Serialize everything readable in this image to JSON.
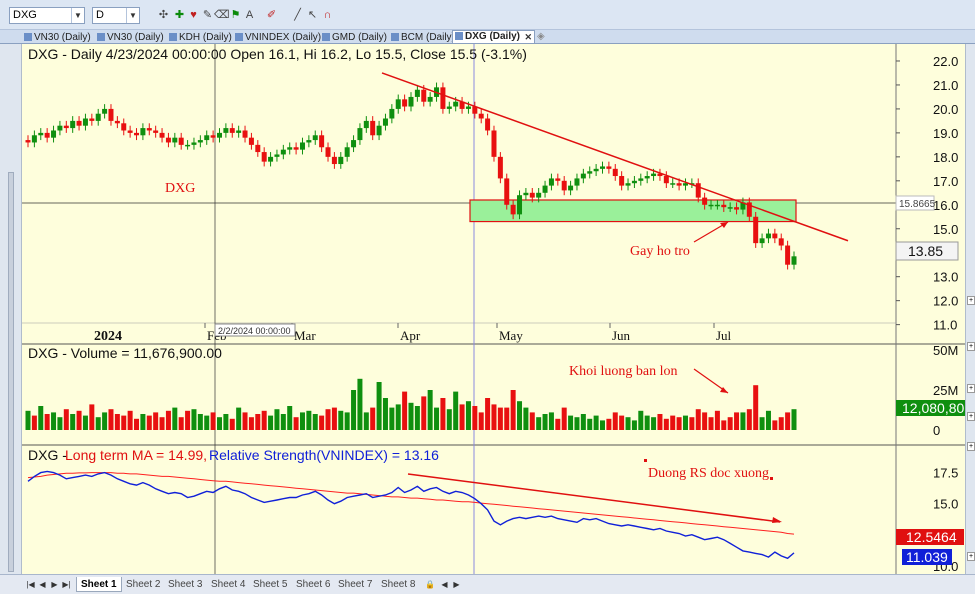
{
  "toolbar": {
    "symbol": "DXG",
    "period": "D",
    "icons": [
      "crosshair-icon",
      "add-chart-icon",
      "heart-icon",
      "draw-icon",
      "eraser-icon",
      "flag-icon",
      "text-icon",
      "pen-color-icon",
      "line-tool-icon",
      "pointer-icon",
      "curve-icon",
      "magnet-icon"
    ]
  },
  "tabs": [
    {
      "label": "VN30 (Daily)",
      "active": false
    },
    {
      "label": "VN30 (Daily)",
      "active": false
    },
    {
      "label": "KDH (Daily)",
      "active": false
    },
    {
      "label": "VNINDEX (Daily)",
      "active": false
    },
    {
      "label": "GMD (Daily)",
      "active": false
    },
    {
      "label": "BCM (Daily)",
      "active": false
    },
    {
      "label": "DXG (Daily)",
      "active": true
    }
  ],
  "colors": {
    "bg": "#fefedc",
    "up": "#0f8f0f",
    "down": "#e81010",
    "ma": "#ff2020",
    "rs": "#1020d8",
    "trend": "#e01010",
    "support_fill": "#9af09a",
    "support_border": "#e01010"
  },
  "chart_data": [
    {
      "type": "candlestick",
      "title": "DXG - Daily 4/23/2024 00:00:00 Open 16.1, Hi 16.2, Lo 15.5, Close 15.5 (-3.1%)",
      "ylim": [
        10.4,
        22.5
      ],
      "yticks": [
        "22.0",
        "21.0",
        "20.0",
        "19.0",
        "18.0",
        "17.0",
        "16.0",
        "15.0",
        "14.0",
        "13.0",
        "12.0",
        "11.0"
      ],
      "x_year_label": "2024",
      "x_month_labels": [
        "Feb",
        "Mar",
        "Apr",
        "May",
        "Jun",
        "Jul"
      ],
      "cursor_date": "2/2/2024 00:00:00",
      "cursor_price": "15.8665",
      "last_price": "13.85",
      "watermark": "DXG",
      "annotations": [
        "Gay ho tro"
      ],
      "close": [
        18.6,
        18.9,
        19.0,
        18.8,
        19.1,
        19.3,
        19.2,
        19.5,
        19.3,
        19.6,
        19.5,
        19.8,
        20.0,
        19.5,
        19.4,
        19.1,
        19.0,
        18.9,
        19.2,
        19.1,
        19.0,
        18.8,
        18.6,
        18.8,
        18.5,
        18.5,
        18.6,
        18.7,
        18.9,
        18.8,
        19.0,
        19.2,
        19.0,
        19.1,
        18.8,
        18.5,
        18.2,
        17.8,
        18.0,
        18.1,
        18.3,
        18.4,
        18.3,
        18.6,
        18.7,
        18.9,
        18.4,
        18.0,
        17.7,
        18.0,
        18.4,
        18.7,
        19.2,
        19.5,
        18.9,
        19.3,
        19.6,
        20.0,
        20.4,
        20.1,
        20.5,
        20.8,
        20.3,
        20.5,
        20.9,
        20.0,
        20.1,
        20.3,
        20.0,
        20.1,
        19.8,
        19.6,
        19.1,
        18.0,
        17.1,
        16.0,
        15.6,
        16.4,
        16.5,
        16.3,
        16.5,
        16.8,
        17.1,
        17.0,
        16.6,
        16.8,
        17.1,
        17.3,
        17.4,
        17.5,
        17.6,
        17.5,
        17.2,
        16.8,
        16.9,
        17.0,
        17.1,
        17.2,
        17.3,
        17.2,
        16.9,
        16.9,
        16.8,
        16.9,
        16.9,
        16.3,
        16.0,
        16.0,
        16.0,
        15.9,
        15.9,
        15.8,
        16.1,
        15.5,
        14.4,
        14.6,
        14.8,
        14.6,
        14.3,
        13.5,
        13.85
      ],
      "volume_header": "DXG - Volume = 11,676,900.00",
      "volume_ylim": [
        0,
        50000000
      ],
      "volume_ticks": [
        "50M",
        "25M",
        "0"
      ],
      "volume_last": "12,080,80",
      "volume_annotations": [
        "Khoi luong ban lon"
      ],
      "volume": [
        12,
        9,
        15,
        10,
        11,
        8,
        13,
        10,
        12,
        9,
        16,
        8,
        11,
        13,
        10,
        9,
        12,
        7,
        10,
        9,
        11,
        8,
        12,
        14,
        8,
        12,
        13,
        10,
        9,
        11,
        8,
        10,
        7,
        14,
        11,
        8,
        10,
        12,
        9,
        13,
        10,
        15,
        8,
        11,
        12,
        10,
        9,
        13,
        14,
        12,
        11,
        25,
        32,
        11,
        14,
        30,
        20,
        14,
        16,
        24,
        17,
        15,
        21,
        25,
        14,
        20,
        13,
        24,
        16,
        18,
        15,
        11,
        20,
        16,
        14,
        14,
        25,
        18,
        14,
        11,
        8,
        10,
        11,
        7,
        14,
        9,
        8,
        10,
        7,
        9,
        6,
        7,
        11,
        9,
        8,
        6,
        12,
        9,
        8,
        10,
        7,
        9,
        8,
        9,
        8,
        13,
        11,
        8,
        12,
        6,
        8,
        11,
        11,
        13,
        28,
        8,
        12,
        6,
        8,
        11,
        13
      ],
      "volume_up": [
        true,
        false,
        true,
        false,
        true,
        true,
        false,
        true,
        false,
        true,
        false,
        true,
        true,
        false,
        false,
        false,
        false,
        false,
        true,
        false,
        false,
        false,
        false,
        true,
        false,
        false,
        true,
        true,
        true,
        false,
        true,
        true,
        false,
        true,
        false,
        false,
        false,
        false,
        true,
        true,
        true,
        true,
        false,
        true,
        true,
        true,
        false,
        false,
        false,
        true,
        true,
        true,
        true,
        true,
        false,
        true,
        true,
        true,
        true,
        false,
        true,
        true,
        false,
        true,
        true,
        false,
        true,
        true,
        false,
        true,
        false,
        false,
        false,
        false,
        false,
        false,
        false,
        true,
        true,
        false,
        true,
        true,
        true,
        false,
        false,
        true,
        true,
        true,
        true,
        true,
        true,
        false,
        false,
        false,
        true,
        true,
        true,
        true,
        true,
        false,
        false,
        false,
        false,
        true,
        false,
        false,
        false,
        false,
        false,
        false,
        false,
        false,
        true,
        false,
        false,
        true,
        true,
        false,
        false,
        false,
        true
      ]
    },
    {
      "type": "line",
      "title": "DXG - Long term MA = 14.99, Relative Strength(VNINDEX) = 13.16",
      "ylim": [
        9.5,
        19.0
      ],
      "yticks": [
        "17.5",
        "15.0",
        "12.5",
        "10.0"
      ],
      "ma_label": "Long term MA = 14.99",
      "rs_label": "Relative Strength(VNINDEX) = 13.16",
      "ma_last": "12.5464",
      "rs_last": "11.039",
      "annotations": [
        "Duong RS doc xuong"
      ],
      "series": [
        {
          "name": "Long term MA",
          "values": [
            17.1,
            17.15,
            17.2,
            17.3,
            17.35,
            17.4,
            17.45,
            17.45,
            17.48,
            17.48,
            17.5,
            17.5,
            17.5,
            17.5,
            17.45,
            17.45,
            17.4,
            17.4,
            17.35,
            17.3,
            17.25,
            17.2,
            17.2,
            17.15,
            17.1,
            17.05,
            17.0,
            16.95,
            16.9,
            16.85,
            16.8,
            16.8,
            16.75,
            16.7,
            16.65,
            16.6,
            16.55,
            16.5,
            16.45,
            16.4,
            16.35,
            16.3,
            16.25,
            16.2,
            16.15,
            16.1,
            16.05,
            16.0,
            15.95,
            15.9,
            15.85,
            15.85,
            15.8,
            15.75,
            15.7,
            15.65,
            15.6,
            15.55,
            15.55,
            15.5,
            15.45,
            15.45,
            15.4,
            15.35,
            15.3,
            15.3,
            15.25,
            15.2,
            15.15,
            15.15,
            15.1,
            15.05,
            15.0,
            14.95,
            14.9,
            14.85,
            14.8,
            14.75,
            14.7,
            14.65,
            14.6,
            14.55,
            14.5,
            14.45,
            14.4,
            14.35,
            14.3,
            14.25,
            14.2,
            14.15,
            14.1,
            14.05,
            14.0,
            13.95,
            13.9,
            13.85,
            13.8,
            13.75,
            13.7,
            13.65,
            13.6,
            13.55,
            13.5,
            13.45,
            13.4,
            13.35,
            13.3,
            13.25,
            13.2,
            13.15,
            13.1,
            13.05,
            13.0,
            12.95,
            12.9,
            12.85,
            12.8,
            12.75,
            12.7,
            12.6,
            12.55
          ]
        },
        {
          "name": "Relative Strength(VNINDEX)",
          "values": [
            16.8,
            17.2,
            17.5,
            17.6,
            17.5,
            17.3,
            17.0,
            17.1,
            17.2,
            17.3,
            17.2,
            17.4,
            17.5,
            17.3,
            17.0,
            16.8,
            16.6,
            16.5,
            16.7,
            16.5,
            16.2,
            16.0,
            15.8,
            15.9,
            15.8,
            15.5,
            15.6,
            15.8,
            16.0,
            15.9,
            16.2,
            16.4,
            16.1,
            16.0,
            15.8,
            15.5,
            15.3,
            15.1,
            15.2,
            15.3,
            15.4,
            15.5,
            15.5,
            15.7,
            15.8,
            16.0,
            15.7,
            15.3,
            15.0,
            15.2,
            15.5,
            15.6,
            15.7,
            15.8,
            15.5,
            15.6,
            15.7,
            15.9,
            16.3,
            15.9,
            16.1,
            16.4,
            16.0,
            16.2,
            16.3,
            16.0,
            15.8,
            16.0,
            15.9,
            15.7,
            15.4,
            15.0,
            14.5,
            13.6,
            13.3,
            13.6,
            13.8,
            13.9,
            13.8,
            13.9,
            14.0,
            13.9,
            14.0,
            13.8,
            13.7,
            13.6,
            13.5,
            13.8,
            13.7,
            13.8,
            13.6,
            13.4,
            13.3,
            13.2,
            13.3,
            13.2,
            13.1,
            13.0,
            12.9,
            13.0,
            12.8,
            12.7,
            12.6,
            12.4,
            12.5,
            12.3,
            12.1,
            12.2,
            12.3,
            12.1,
            11.8,
            11.5,
            11.2,
            11.1,
            11.0,
            10.9,
            10.7,
            11.1,
            10.8,
            10.6,
            11.039
          ]
        }
      ]
    }
  ],
  "status": {
    "sheets": [
      "Sheet 1",
      "Sheet 2",
      "Sheet 3",
      "Sheet 4",
      "Sheet 5",
      "Sheet 6",
      "Sheet 7",
      "Sheet 8"
    ],
    "active_sheet": "Sheet 1"
  }
}
